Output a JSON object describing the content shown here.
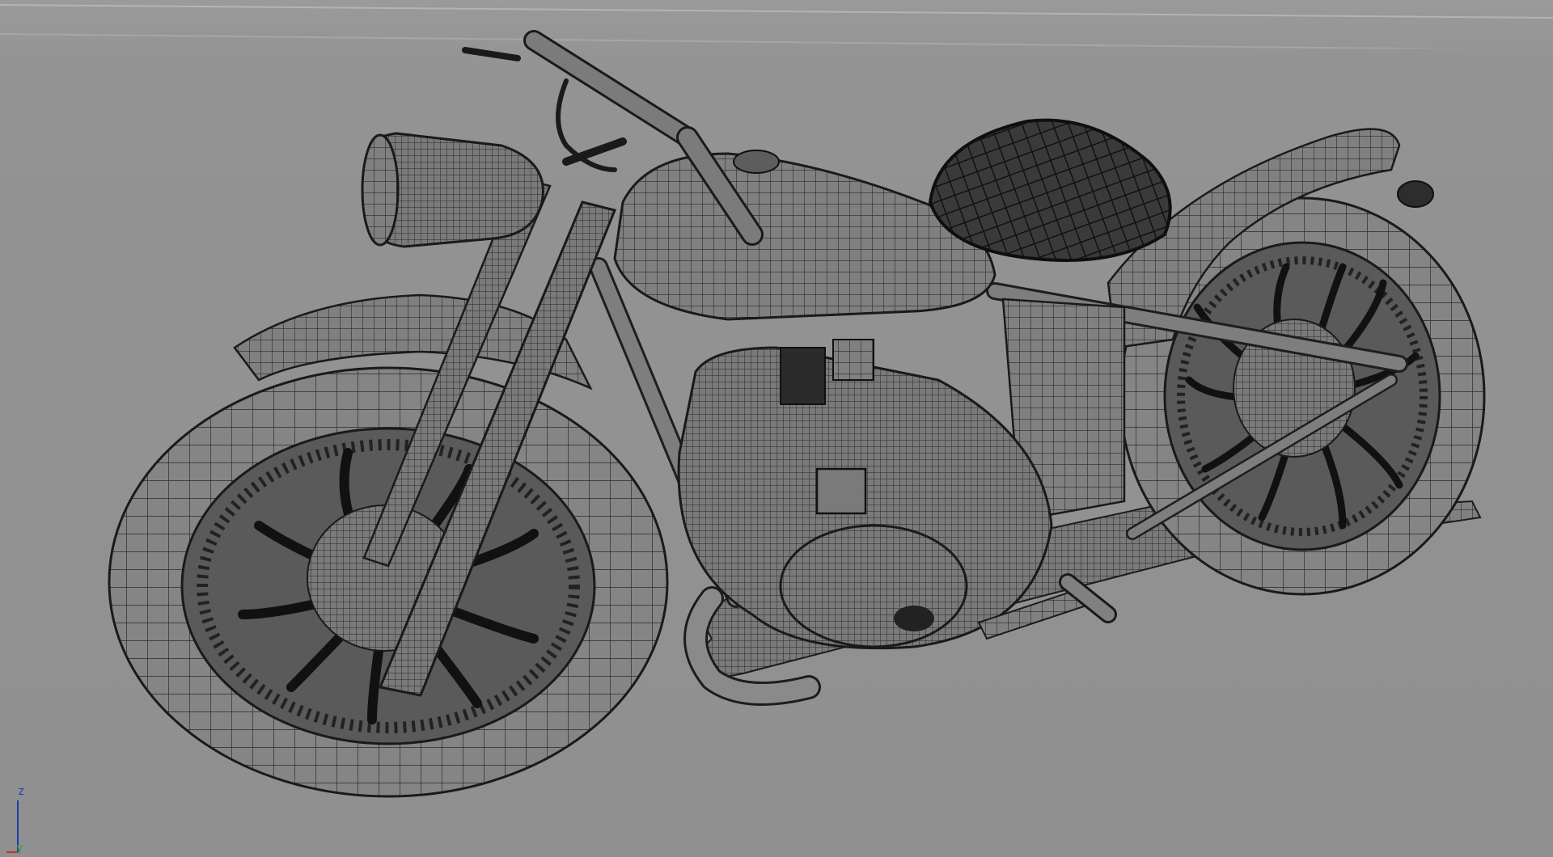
{
  "viewport": {
    "background": "#909090",
    "wire_color": "#2a2a2a",
    "surface_color": "#7d7d7d"
  },
  "axis_gizmo": {
    "z_label": "z",
    "y_label": "y",
    "x_color": "#c8302a",
    "y_color": "#2ea52e",
    "z_color": "#1a3fb5"
  },
  "model": {
    "subject": "motorcycle-wireframe"
  }
}
